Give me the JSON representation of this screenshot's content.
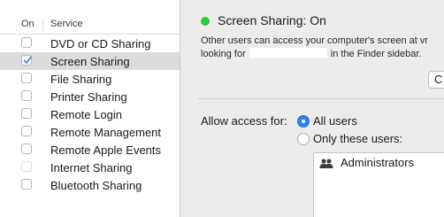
{
  "service_list": {
    "header_on": "On",
    "header_service": "Service",
    "items": [
      {
        "label": "DVD or CD Sharing",
        "checked": false,
        "disabled": false,
        "selected": false
      },
      {
        "label": "Screen Sharing",
        "checked": true,
        "disabled": false,
        "selected": true
      },
      {
        "label": "File Sharing",
        "checked": false,
        "disabled": false,
        "selected": false
      },
      {
        "label": "Printer Sharing",
        "checked": false,
        "disabled": false,
        "selected": false
      },
      {
        "label": "Remote Login",
        "checked": false,
        "disabled": false,
        "selected": false
      },
      {
        "label": "Remote Management",
        "checked": false,
        "disabled": false,
        "selected": false
      },
      {
        "label": "Remote Apple Events",
        "checked": false,
        "disabled": false,
        "selected": false
      },
      {
        "label": "Internet Sharing",
        "checked": false,
        "disabled": true,
        "selected": false
      },
      {
        "label": "Bluetooth Sharing",
        "checked": false,
        "disabled": false,
        "selected": false
      }
    ]
  },
  "status": {
    "title": "Screen Sharing: On",
    "indicator_color": "#2fc93c",
    "description_line1": "Other users can access your computer's screen at vr",
    "description_line2_prefix": "looking for",
    "description_line2_suffix": "in the Finder sidebar.",
    "computer_settings_button_partial": "C"
  },
  "access": {
    "label": "Allow access for:",
    "option_all": "All users",
    "option_only": "Only these users:",
    "selected_option": "All users",
    "users": [
      {
        "name": "Administrators",
        "icon": "group-icon"
      }
    ]
  },
  "colors": {
    "accent": "#2f7ff3",
    "selection": "#dcdcdc"
  }
}
